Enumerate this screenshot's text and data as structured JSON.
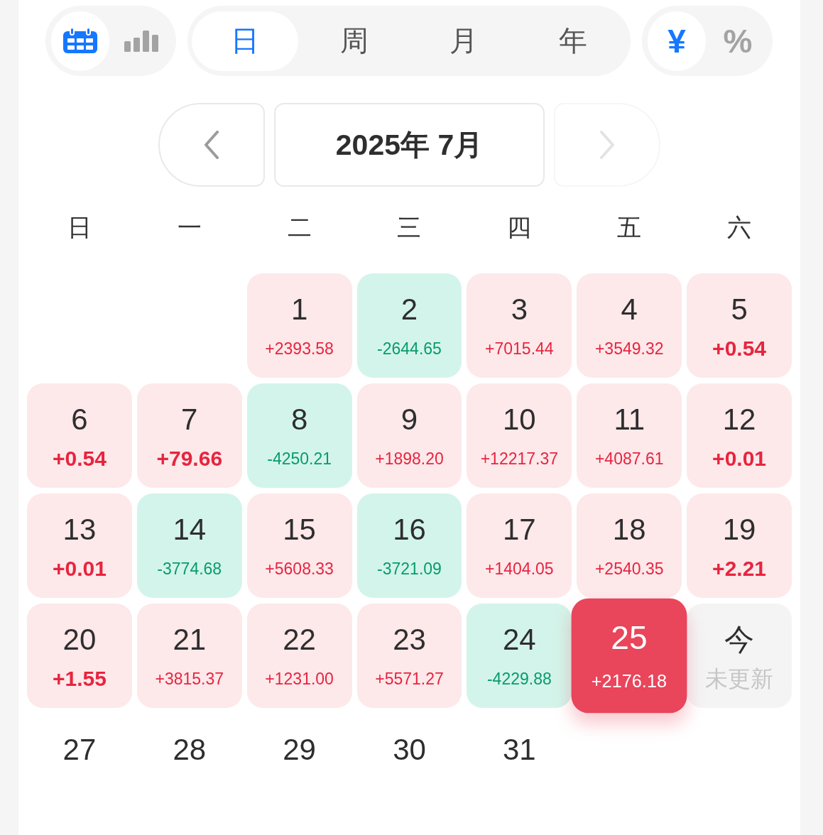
{
  "view_toggle": [
    {
      "kind": "calendar",
      "selected": true
    },
    {
      "kind": "chart",
      "selected": false
    }
  ],
  "period_tabs": [
    {
      "label": "日",
      "selected": true
    },
    {
      "label": "周",
      "selected": false
    },
    {
      "label": "月",
      "selected": false
    },
    {
      "label": "年",
      "selected": false
    }
  ],
  "unit_toggle": [
    {
      "label": "¥",
      "selected": true
    },
    {
      "label": "%",
      "selected": false
    }
  ],
  "nav": {
    "previous_button": {
      "disabled": false
    },
    "title": "2025年 7月",
    "next_button": {
      "disabled": true
    }
  },
  "calendar": {
    "weekdays": [
      "日",
      "一",
      "二",
      "三",
      "四",
      "五",
      "六"
    ],
    "days": [
      {
        "kind": "blank"
      },
      {
        "kind": "blank"
      },
      {
        "day": "1",
        "value": "+2393.58",
        "kind": "gain",
        "selected": false
      },
      {
        "day": "2",
        "value": "-2644.65",
        "kind": "loss",
        "selected": false
      },
      {
        "day": "3",
        "value": "+7015.44",
        "kind": "gain",
        "selected": false
      },
      {
        "day": "4",
        "value": "+3549.32",
        "kind": "gain",
        "selected": false
      },
      {
        "day": "5",
        "value": "+0.54",
        "kind": "gain",
        "selected": false
      },
      {
        "day": "6",
        "value": "+0.54",
        "kind": "gain",
        "selected": false
      },
      {
        "day": "7",
        "value": "+79.66",
        "kind": "gain",
        "selected": false
      },
      {
        "day": "8",
        "value": "-4250.21",
        "kind": "loss",
        "selected": false
      },
      {
        "day": "9",
        "value": "+1898.20",
        "kind": "gain",
        "selected": false
      },
      {
        "day": "10",
        "value": "+12217.37",
        "kind": "gain",
        "selected": false
      },
      {
        "day": "11",
        "value": "+4087.61",
        "kind": "gain",
        "selected": false
      },
      {
        "day": "12",
        "value": "+0.01",
        "kind": "gain",
        "selected": false
      },
      {
        "day": "13",
        "value": "+0.01",
        "kind": "gain",
        "selected": false
      },
      {
        "day": "14",
        "value": "-3774.68",
        "kind": "loss",
        "selected": false
      },
      {
        "day": "15",
        "value": "+5608.33",
        "kind": "gain",
        "selected": false
      },
      {
        "day": "16",
        "value": "-3721.09",
        "kind": "loss",
        "selected": false
      },
      {
        "day": "17",
        "value": "+1404.05",
        "kind": "gain",
        "selected": false
      },
      {
        "day": "18",
        "value": "+2540.35",
        "kind": "gain",
        "selected": false
      },
      {
        "day": "19",
        "value": "+2.21",
        "kind": "gain",
        "selected": false
      },
      {
        "day": "20",
        "value": "+1.55",
        "kind": "gain",
        "selected": false
      },
      {
        "day": "21",
        "value": "+3815.37",
        "kind": "gain",
        "selected": false
      },
      {
        "day": "22",
        "value": "+1231.00",
        "kind": "gain",
        "selected": false
      },
      {
        "day": "23",
        "value": "+5571.27",
        "kind": "gain",
        "selected": false
      },
      {
        "day": "24",
        "value": "-4229.88",
        "kind": "loss",
        "selected": false
      },
      {
        "day": "25",
        "value": "+2176.18",
        "kind": "gain",
        "selected": true
      },
      {
        "day": "今",
        "value": "未更新",
        "kind": "pending",
        "selected": false
      },
      {
        "day": "27",
        "kind": "future",
        "selected": false
      },
      {
        "day": "28",
        "kind": "future",
        "selected": false
      },
      {
        "day": "29",
        "kind": "future",
        "selected": false
      },
      {
        "day": "30",
        "kind": "future",
        "selected": false
      },
      {
        "day": "31",
        "kind": "future",
        "selected": false
      }
    ]
  }
}
